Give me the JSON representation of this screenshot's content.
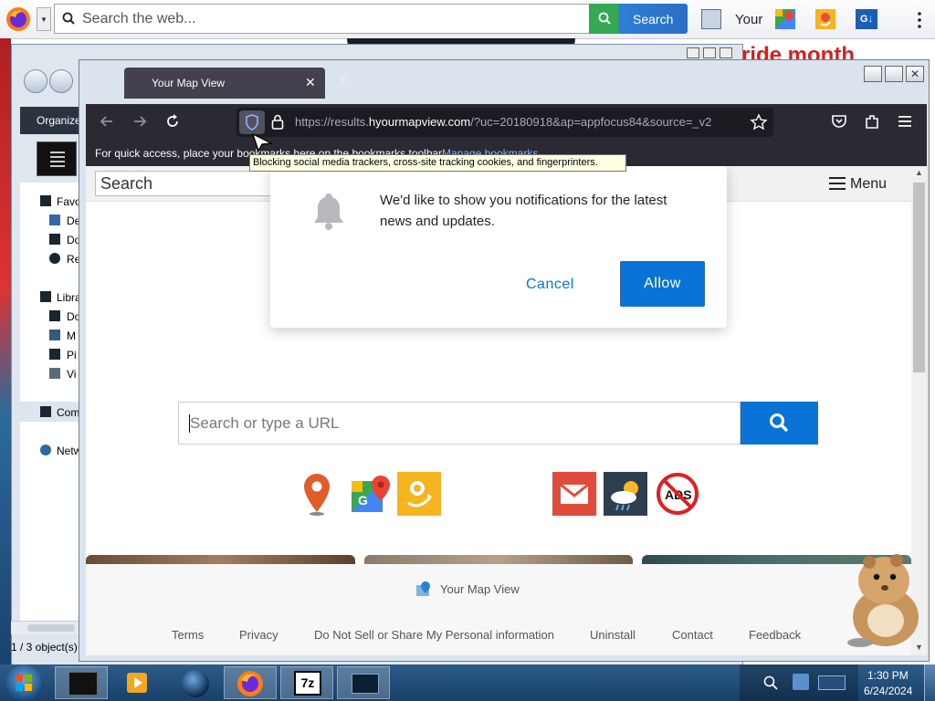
{
  "top_toolbar": {
    "search_placeholder": "Search the web...",
    "search_button": "Search",
    "your_label": "Your"
  },
  "background": {
    "red_text": "ride month",
    "explorer": {
      "organize_label": "Organize",
      "nav_items": [
        "Favo",
        "De",
        "Do",
        "Re",
        "Libra",
        "Do",
        "M",
        "Pi",
        "Vi",
        "Com",
        "Netw"
      ],
      "status": "1 / 3 object(s)"
    }
  },
  "browser": {
    "tab_title": "Your Map View",
    "url_prefix": "https://results.",
    "url_domain": "hyourmapview.com",
    "url_suffix": "/?uc=20180918&ap=appfocus84&source=_v2",
    "bookmarks_hint": "For quick access, place your bookmarks here on the bookmarks toolbar.",
    "manage_bookmarks": "Manage bookmarks",
    "tooltip": "Blocking social media trackers, cross-site tracking cookies, and fingerprinters."
  },
  "page": {
    "search_placeholder": "Search",
    "menu_label": "Menu",
    "main_search_placeholder": "Search or type a URL",
    "footer_brand": "Your Map View",
    "footer_links": [
      "Terms",
      "Privacy",
      "Do Not Sell or Share My Personal information",
      "Uninstall",
      "Contact",
      "Feedback"
    ]
  },
  "notification": {
    "message": "We'd like to show you notifications for the latest news and updates.",
    "cancel": "Cancel",
    "allow": "Allow"
  },
  "taskbar": {
    "time": "1:30 PM",
    "date": "6/24/2024"
  },
  "colors": {
    "accent": "#0a74d6",
    "search_green": "#34a853",
    "firefox_dark": "#2b2a33",
    "taskbar": "#1f4b78"
  }
}
